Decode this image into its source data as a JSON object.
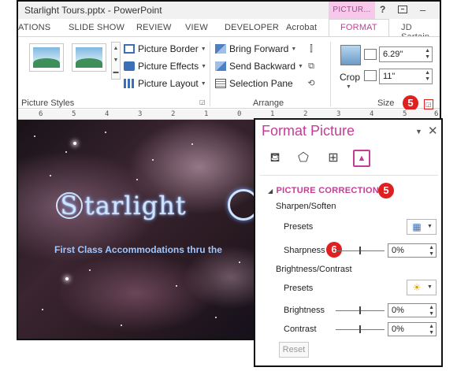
{
  "window": {
    "title": "Starlight Tours.pptx - PowerPoint",
    "contextual_tab": "PICTUR...",
    "help_glyph": "?",
    "min_glyph": "–"
  },
  "tabs": [
    {
      "label": "ATIONS"
    },
    {
      "label": "SLIDE SHOW"
    },
    {
      "label": "REVIEW"
    },
    {
      "label": "VIEW"
    },
    {
      "label": "DEVELOPER"
    },
    {
      "label": "Acrobat"
    },
    {
      "label": "FORMAT",
      "active": true
    },
    {
      "label": "JD Sartain"
    }
  ],
  "ribbon": {
    "picture_styles": {
      "commands": [
        "Picture Border",
        "Picture Effects",
        "Picture Layout"
      ],
      "label": "Picture Styles"
    },
    "arrange": {
      "commands": [
        "Bring Forward",
        "Send Backward",
        "Selection Pane"
      ],
      "label": "Arrange"
    },
    "size": {
      "crop_label": "Crop",
      "height": "6.29\"",
      "width": "11\"",
      "label": "Size"
    },
    "callout_number": "5"
  },
  "ruler": {
    "ticks": [
      "6",
      "5",
      "4",
      "3",
      "2",
      "1",
      "0",
      "1",
      "2",
      "3",
      "4",
      "5",
      "6"
    ]
  },
  "slide": {
    "title_initial": "S",
    "title_rest": "tarlight",
    "subtitle": "First Class Accommodations thru the"
  },
  "pane": {
    "title": "Format Picture",
    "section_title": "PICTURE CORRECTIONS",
    "section_callout": "5",
    "sharpen_group": "Sharpen/Soften",
    "presets_label_1": "Presets",
    "sharpness_label": "Sharpness",
    "sharpness_callout": "6",
    "sharpness_value": "0%",
    "brightness_group": "Brightness/Contrast",
    "presets_label_2": "Presets",
    "brightness_label": "Brightness",
    "brightness_value": "0%",
    "contrast_label": "Contrast",
    "contrast_value": "0%",
    "reset_label": "Reset"
  },
  "colors": {
    "accent": "#c43e95",
    "callout": "#e02020",
    "contextual_tab_bg": "#f6c9ea"
  },
  "icons": {
    "fill_line": "paint-bucket-icon",
    "effects": "pentagon-icon",
    "size_properties": "size-properties-icon",
    "picture": "picture-icon"
  }
}
